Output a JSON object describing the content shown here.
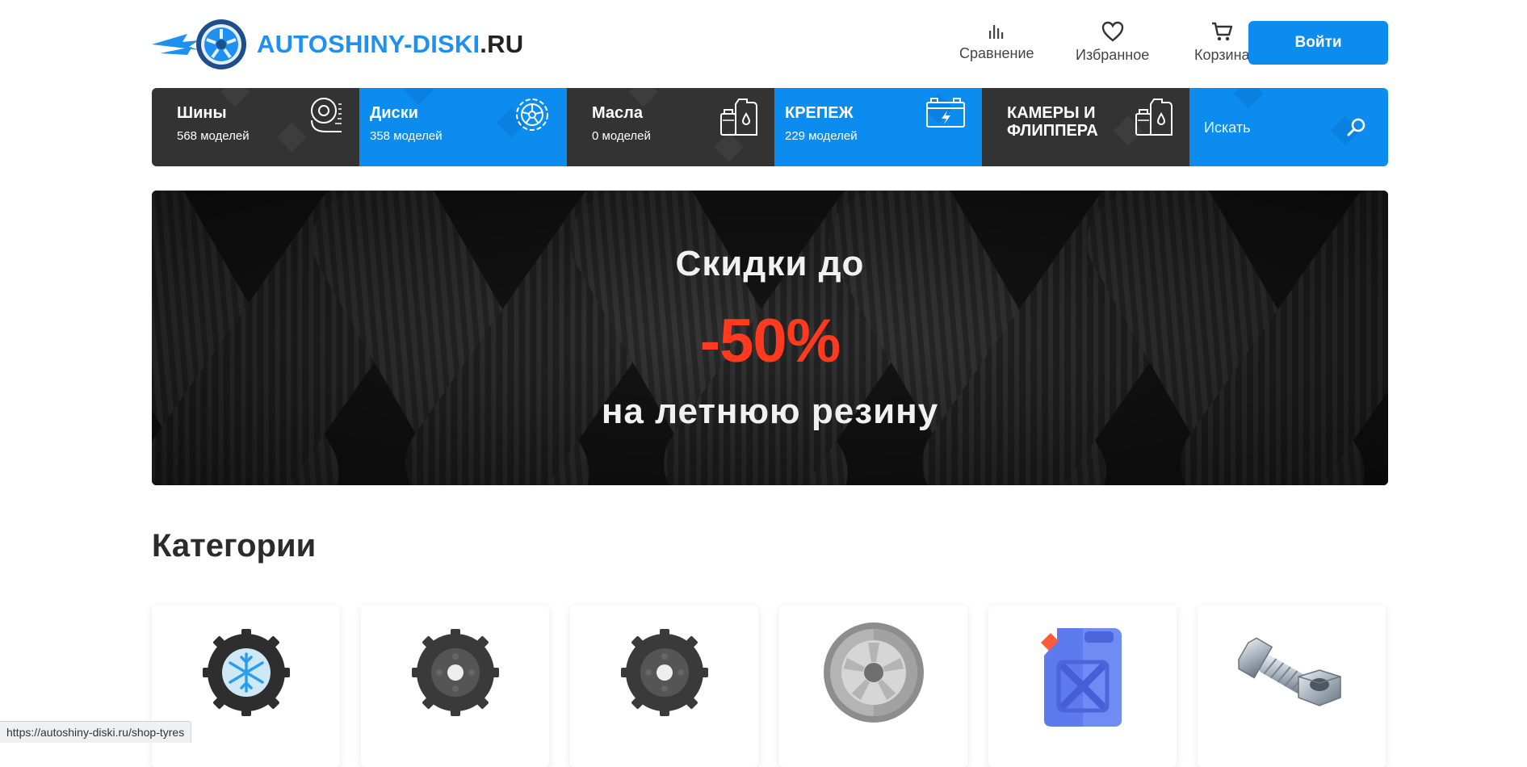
{
  "header": {
    "logo": {
      "main": "AUTOSHINY-DISKI",
      "tld": ".RU",
      "icon": "wheel-logo-icon"
    },
    "nav": [
      {
        "label": "Сравнение",
        "icon": "compare-chart-icon"
      },
      {
        "label": "Избранное",
        "icon": "heart-icon"
      },
      {
        "label": "Корзина",
        "icon": "cart-icon"
      }
    ],
    "login_label": "Войти"
  },
  "catbar": {
    "items": [
      {
        "name": "Шины",
        "count": "568 моделей",
        "icon": "tyre-icon"
      },
      {
        "name": "Диски",
        "count": "358 моделей",
        "icon": "rim-icon"
      },
      {
        "name": "Масла",
        "count": "0 моделей",
        "icon": "oil-canister-icon"
      },
      {
        "name": "КРЕПЕЖ",
        "count": "229 моделей",
        "icon": "battery-icon"
      },
      {
        "name": "КАМЕРЫ И ФЛИППЕРА",
        "count": "",
        "icon": "oil-canister-icon"
      }
    ],
    "search_placeholder": "Искать",
    "search_icon": "search-icon"
  },
  "banner": {
    "line1": "Скидки до",
    "line2": "-50%",
    "line3": "на летнюю резину"
  },
  "categories": {
    "title": "Категории",
    "cards": [
      {
        "icon": "winter-tyre-icon"
      },
      {
        "icon": "tyre-icon"
      },
      {
        "icon": "tyre-icon"
      },
      {
        "icon": "alloy-wheel-icon"
      },
      {
        "icon": "jerrycan-icon"
      },
      {
        "icon": "bolt-nut-icon"
      }
    ]
  },
  "statusbar": {
    "url": "https://autoshiny-diski.ru/shop-tyres"
  },
  "colors": {
    "brand_blue": "#0d8cf0",
    "dark": "#333333",
    "sale_red": "#ff3a1f"
  }
}
